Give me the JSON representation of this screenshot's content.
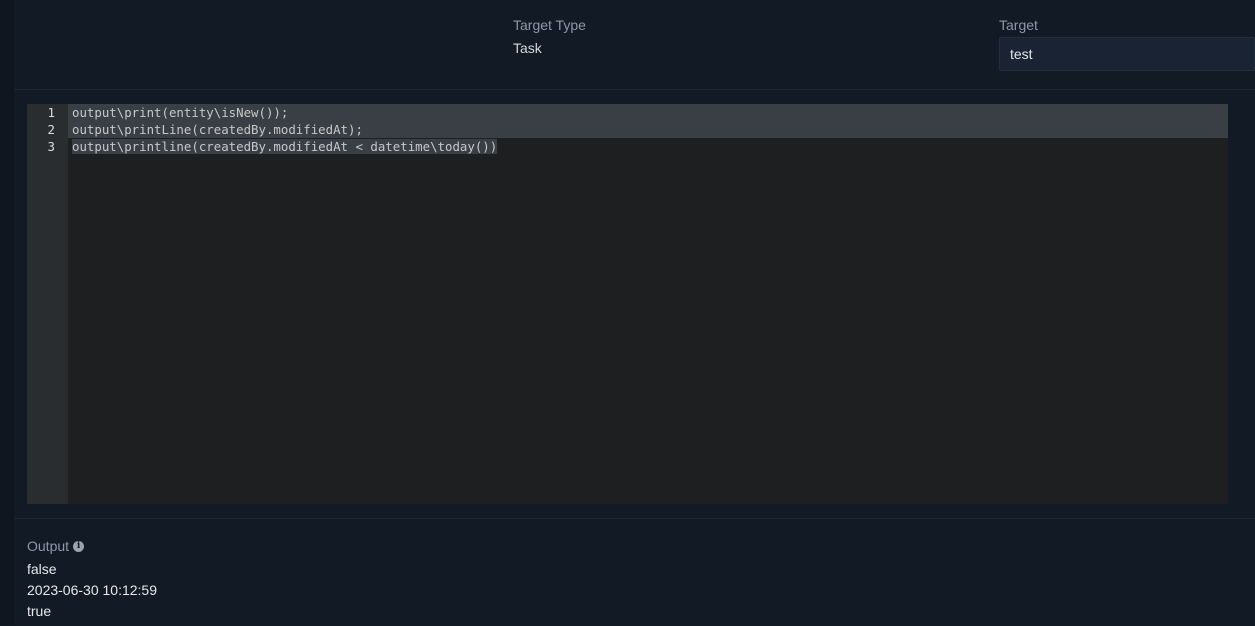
{
  "header": {
    "target_type_label": "Target Type",
    "target_type_value": "Task",
    "target_label": "Target",
    "target_input_value": "test"
  },
  "editor": {
    "line_numbers": [
      "1",
      "2",
      "3"
    ],
    "lines": [
      "output\\print(entity\\isNew());",
      "output\\printLine(createdBy.modifiedAt);",
      "output\\printline(createdBy.modifiedAt < datetime\\today())"
    ]
  },
  "output": {
    "label": "Output",
    "info_icon": "info-icon",
    "lines": [
      "false",
      "2023-06-30 10:12:59",
      "true"
    ]
  },
  "colors": {
    "background": "#121a26",
    "editor_background": "#1e1f20",
    "gutter_background": "#2a2d30",
    "selection": "#3a3e45"
  }
}
